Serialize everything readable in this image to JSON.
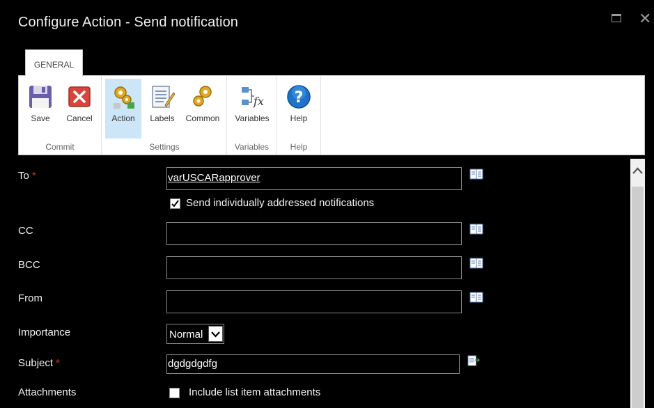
{
  "window": {
    "title": "Configure Action - Send notification",
    "maximize_label": "",
    "close_label": "✕"
  },
  "ribbon": {
    "tab_label": "GENERAL",
    "groups": [
      {
        "label": "Commit",
        "buttons": [
          {
            "label": "Save"
          },
          {
            "label": "Cancel"
          }
        ]
      },
      {
        "label": "Settings",
        "buttons": [
          {
            "label": "Action"
          },
          {
            "label": "Labels"
          },
          {
            "label": "Common"
          }
        ]
      },
      {
        "label": "Variables",
        "buttons": [
          {
            "label": "Variables"
          }
        ]
      },
      {
        "label": "Help",
        "buttons": [
          {
            "label": "Help"
          }
        ]
      }
    ]
  },
  "form": {
    "required_marker": "*",
    "to": {
      "label": "To",
      "value": "varUSCARapprover"
    },
    "individual": {
      "label": "Send individually addressed notifications",
      "checked": true
    },
    "cc": {
      "label": "CC",
      "value": ""
    },
    "bcc": {
      "label": "BCC",
      "value": ""
    },
    "from": {
      "label": "From",
      "value": ""
    },
    "importance": {
      "label": "Importance",
      "value": "Normal"
    },
    "subject": {
      "label": "Subject",
      "value": "dgdgdgdfg"
    },
    "attachments": {
      "label": "Attachments",
      "option_label": "Include list item attachments",
      "checked": false
    }
  },
  "colors": {
    "accent": "#cde6f7",
    "required": "#d0342c",
    "background": "#000000"
  }
}
